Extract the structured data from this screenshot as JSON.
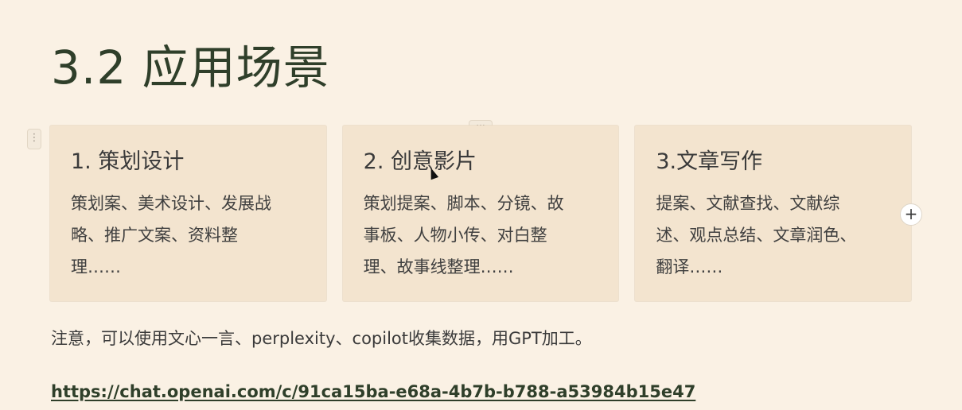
{
  "page": {
    "title": "3.2 应用场景"
  },
  "cards": [
    {
      "title": "1. 策划设计",
      "lines": [
        "策划案、美术设计、发展战",
        "略、推广文案、资料整",
        "理……"
      ]
    },
    {
      "title": "2. 创意影片",
      "lines": [
        "策划提案、脚本、分镜、故",
        "事板、人物小传、对白整",
        "理、故事线整理……"
      ]
    },
    {
      "title": "3.文章写作",
      "lines": [
        "提案、文献查找、文献综",
        "述、观点总结、文章润色、",
        "翻译……"
      ]
    }
  ],
  "controls": {
    "drag_handle_icon": "⋮",
    "more_icon": "···",
    "add_icon": "+"
  },
  "note": "注意，可以使用文心一言、perplexity、copilot收集数据，用GPT加工。",
  "link": "https://chat.openai.com/c/91ca15ba-e68a-4b7b-b788-a53984b15e47"
}
